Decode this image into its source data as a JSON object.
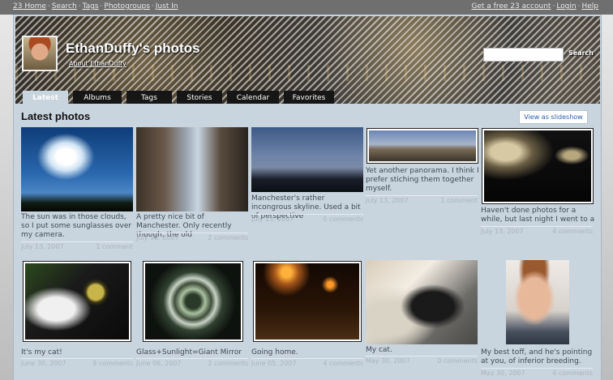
{
  "topnav": {
    "left": [
      "23 Home",
      "Search",
      "Tags",
      "Photogroups",
      "Just In"
    ],
    "right": [
      "Get a free 23 account",
      "Login",
      "Help"
    ]
  },
  "site": {
    "title": "EthanDuffy's photos",
    "about": "About EthanDuffy",
    "search_button": "Search",
    "search_value": ""
  },
  "tabs": [
    "Latest",
    "Albums",
    "Tags",
    "Stories",
    "Calendar",
    "Favorites"
  ],
  "section_title": "Latest photos",
  "slideshow_label": "View as slideshow",
  "photos": [
    {
      "caption": "The sun was in those clouds, so I put some sunglasses over my camera.",
      "date": "July 13, 2007",
      "comments": "1 comment"
    },
    {
      "caption": "A pretty nice bit of Manchester. Only recently though, the old",
      "date": "July 13, 2007",
      "comments": "2 comments"
    },
    {
      "caption": "Manchester's rather incongrous skyline. Used a bit of perspective",
      "date": "July 13, 2007",
      "comments": "0 comments"
    },
    {
      "caption": "Yet another panorama. I think I prefer stiching them together myself.",
      "date": "July 13, 2007",
      "comments": "1 comment"
    },
    {
      "caption": "Haven't done photos for a while, but last night I went to a",
      "date": "July 13, 2007",
      "comments": "4 comments"
    },
    {
      "caption": "It's my cat!",
      "date": "June 30, 2007",
      "comments": "9 comments"
    },
    {
      "caption": "Glass+Sunlight=Giant Mirror",
      "date": "June 06, 2007",
      "comments": "2 comments"
    },
    {
      "caption": "Going home.",
      "date": "June 05, 2007",
      "comments": "4 comments"
    },
    {
      "caption": "My cat.",
      "date": "May 30, 2007",
      "comments": "0 comments"
    },
    {
      "caption": "My best toff, and he's pointing at you, of inferior breeding.",
      "date": "May 30, 2007",
      "comments": "4 comments"
    }
  ]
}
